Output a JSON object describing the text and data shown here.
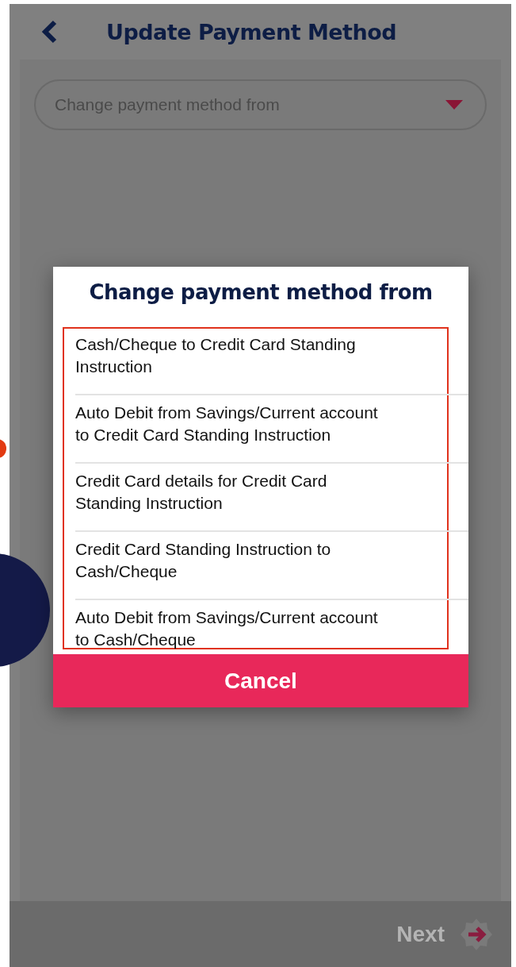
{
  "header": {
    "title": "Update Payment Method"
  },
  "dropdown": {
    "placeholder": "Change payment method from"
  },
  "dialog": {
    "title": "Change payment method from",
    "options": [
      {
        "label": "Cash/Cheque to Credit Card Standing Instruction"
      },
      {
        "label": "Auto Debit from Savings/Current account to Credit Card Standing Instruction"
      },
      {
        "label": "Credit Card details for Credit Card Standing Instruction"
      },
      {
        "label": "Credit Card Standing Instruction to Cash/Cheque"
      },
      {
        "label": "Auto Debit from Savings/Current account to Cash/Cheque"
      }
    ],
    "cancel": "Cancel"
  },
  "footer": {
    "next": "Next"
  }
}
